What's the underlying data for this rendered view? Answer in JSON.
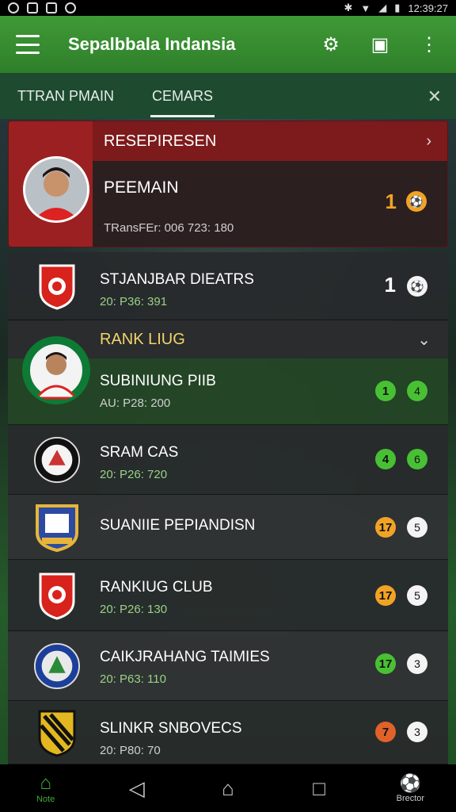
{
  "status": {
    "time": "12:39:27"
  },
  "app": {
    "title": "Sepalbbala Indansia"
  },
  "tabs": [
    {
      "label": "TTRAN PMAIN"
    },
    {
      "label": "CEMARS"
    }
  ],
  "feature": {
    "header": "RESEPIRESEN",
    "name": "PEEMAIN",
    "transfer": "TRansFEr: 006 723: 180",
    "rank": "1"
  },
  "items": [
    {
      "name": "STJANJBAR DIEATRS",
      "sub": "20: P36: 391",
      "rank": "1"
    },
    {
      "section": "RANK LIUG"
    },
    {
      "name": "SUBINIUNG PIIB",
      "sub": "AU: P28: 200",
      "rank": "1",
      "ball": "4"
    },
    {
      "name": "SRAM CAS",
      "sub": "20: P26: 720",
      "rank": "4",
      "ball": "6"
    },
    {
      "name": "SUANIIE PEPIANDISN",
      "sub": "",
      "rank": "17",
      "ball": "5"
    },
    {
      "name": "RANKIUG CLUB",
      "sub": "20: P26: 130",
      "rank": "17",
      "ball": "5"
    },
    {
      "name": "CAIKJRAHANG TAIMIES",
      "sub": "20: P63: 110",
      "rank": "17",
      "ball": "3"
    },
    {
      "name": "SLINKR SNBOVECS",
      "sub": "20: P80: 70",
      "rank": "7",
      "ball": "3"
    }
  ],
  "nav": [
    {
      "label": "Note"
    },
    {
      "label": ""
    },
    {
      "label": ""
    },
    {
      "label": ""
    },
    {
      "label": "Brector"
    }
  ],
  "colors": {
    "green": "#3f9a36",
    "red_header": "#7d1a1c",
    "gold": "#f2d56a",
    "badge_green": "#48c034",
    "badge_orange": "#f1a326"
  }
}
